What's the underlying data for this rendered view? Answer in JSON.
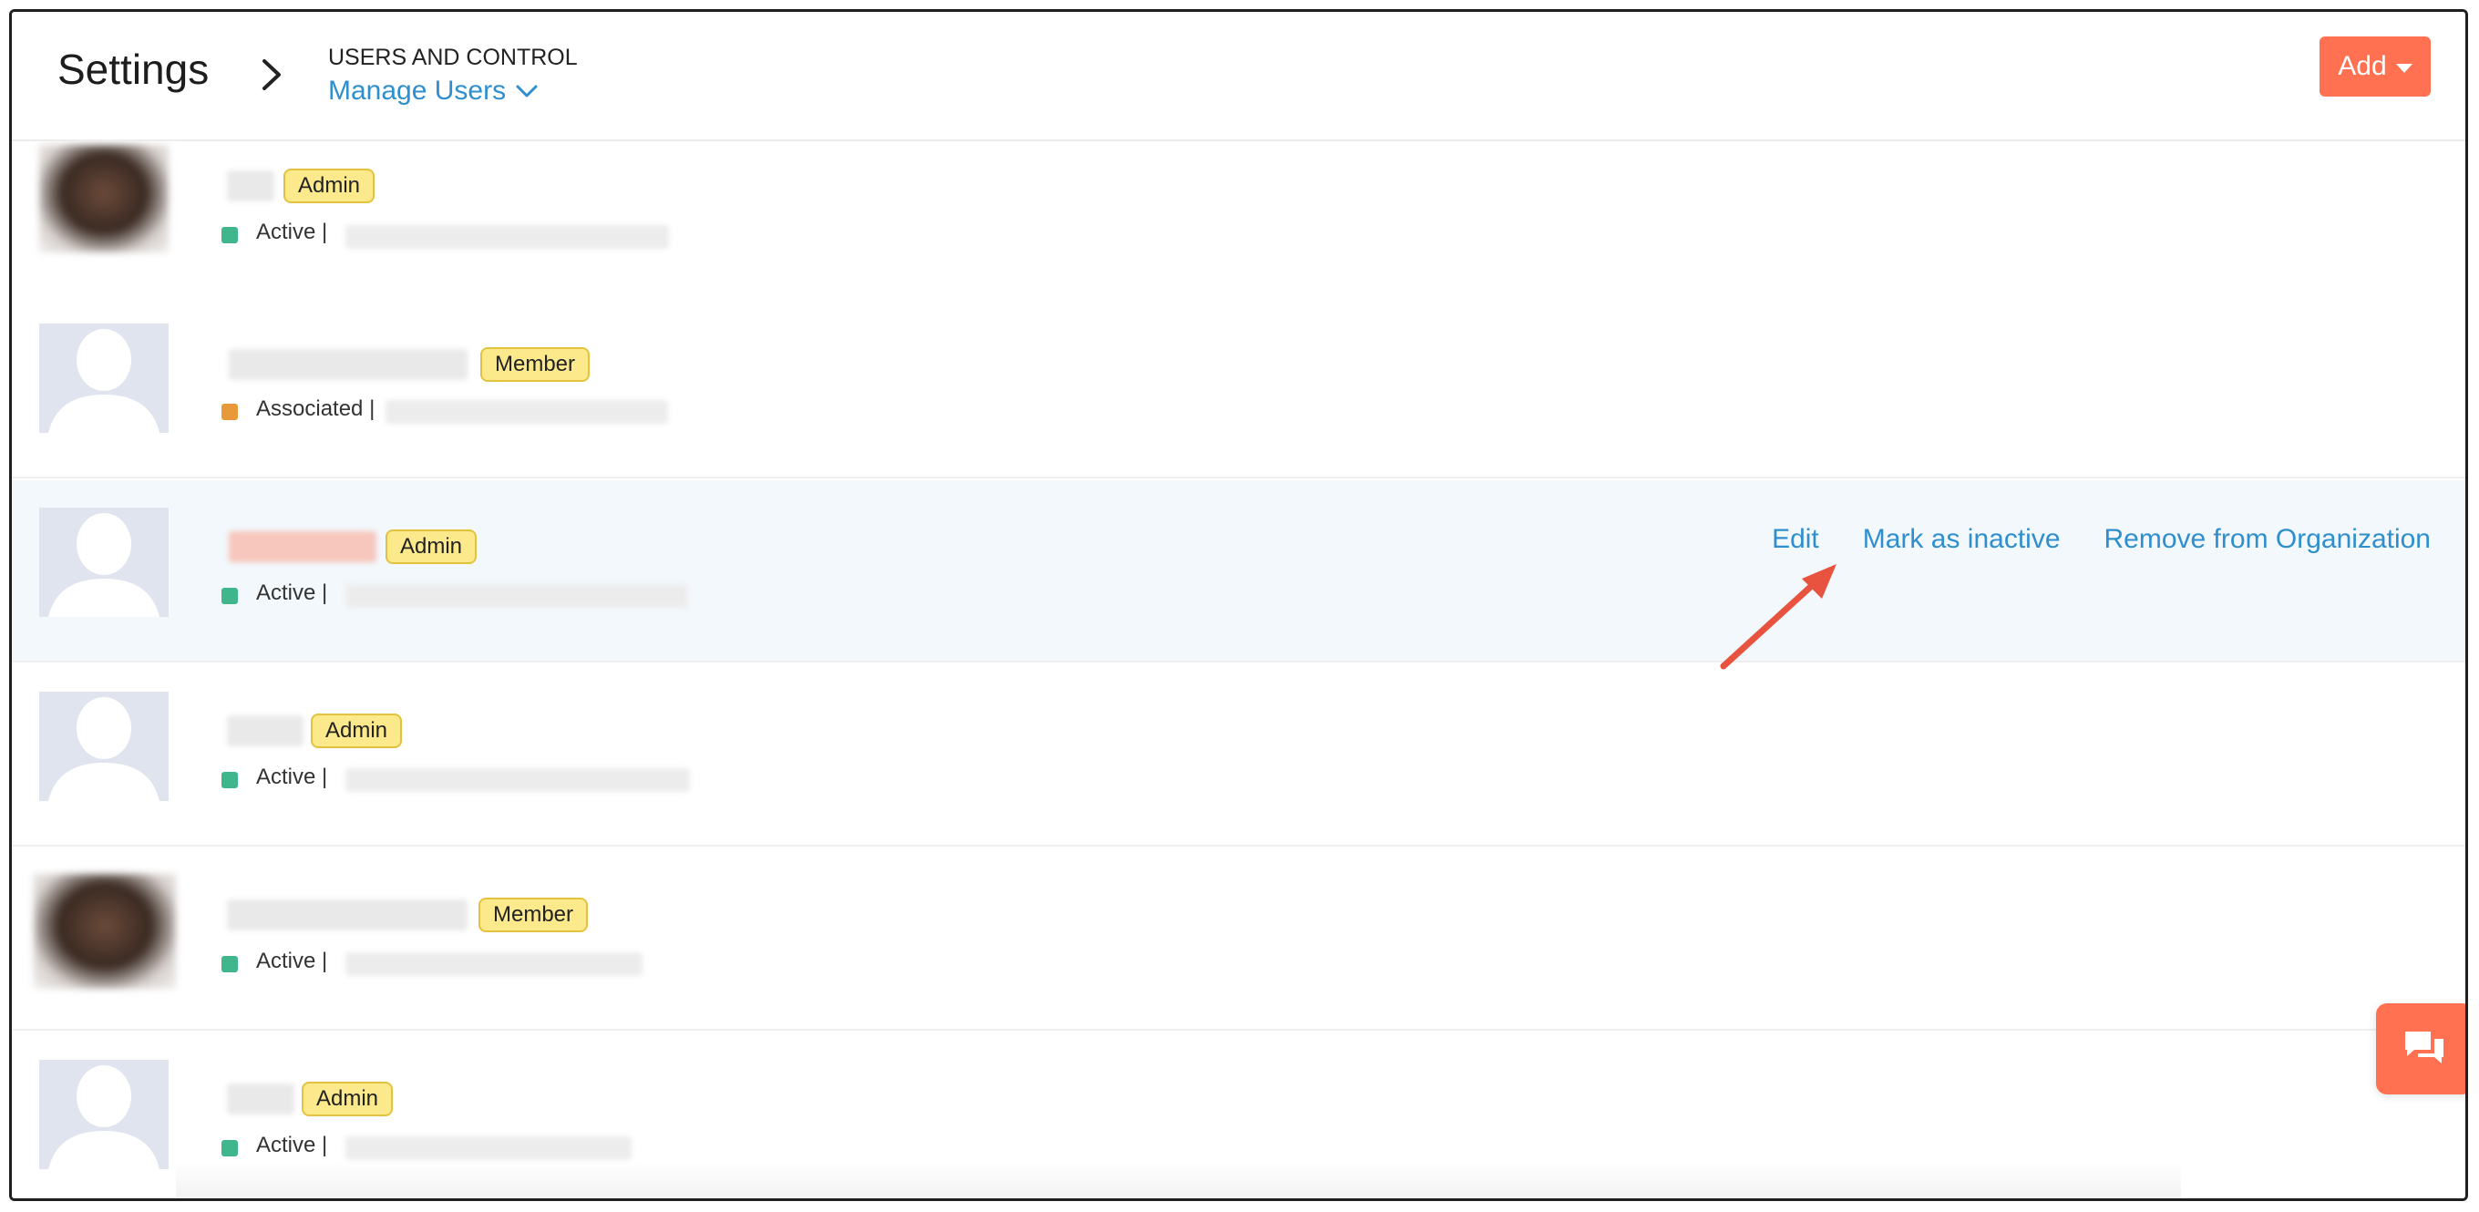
{
  "header": {
    "title": "Settings",
    "section": "USERS AND CONTROL",
    "current_page": "Manage Users",
    "add_label": "Add"
  },
  "users": [
    {
      "role": "Admin",
      "status": "Active",
      "status_color": "#3fb68b",
      "avatar": "photo"
    },
    {
      "role": "Member",
      "status": "Associated",
      "status_color": "#e8993a",
      "avatar": "placeholder"
    },
    {
      "role": "Admin",
      "status": "Active",
      "status_color": "#3fb68b",
      "avatar": "placeholder"
    },
    {
      "role": "Admin",
      "status": "Active",
      "status_color": "#3fb68b",
      "avatar": "placeholder"
    },
    {
      "role": "Member",
      "status": "Active",
      "status_color": "#3fb68b",
      "avatar": "photo"
    },
    {
      "role": "Admin",
      "status": "Active",
      "status_color": "#3fb68b",
      "avatar": "placeholder"
    }
  ],
  "row_actions": {
    "edit": "Edit",
    "mark_inactive": "Mark as inactive",
    "remove": "Remove from Organization"
  },
  "colors": {
    "accent": "#ff7150",
    "link": "#2f8fce",
    "badge": "#fce98b",
    "highlight_row": "#f3f8fc"
  },
  "icons": [
    "chevron-right-icon",
    "chevron-down-icon",
    "caret-down-icon",
    "chat-icon",
    "arrow-annotation"
  ]
}
